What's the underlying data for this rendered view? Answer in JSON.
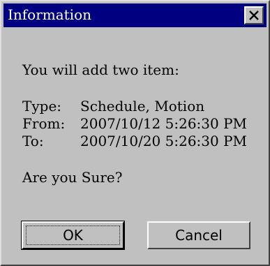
{
  "window": {
    "title": "Information"
  },
  "message": {
    "intro": "You will add two item:",
    "rows": [
      {
        "label": "Type:",
        "value": "Schedule, Motion"
      },
      {
        "label": "From:",
        "value": "2007/10/12 5:26:30 PM"
      },
      {
        "label": "To:",
        "value": "2007/10/20 5:26:30 PM"
      }
    ],
    "question": "Are you Sure?"
  },
  "buttons": {
    "ok_label": "OK",
    "cancel_label": "Cancel"
  },
  "colors": {
    "titlebar": "#000080",
    "dialog_bg": "#c0c0c0"
  },
  "icons": {
    "close": "close-icon"
  }
}
